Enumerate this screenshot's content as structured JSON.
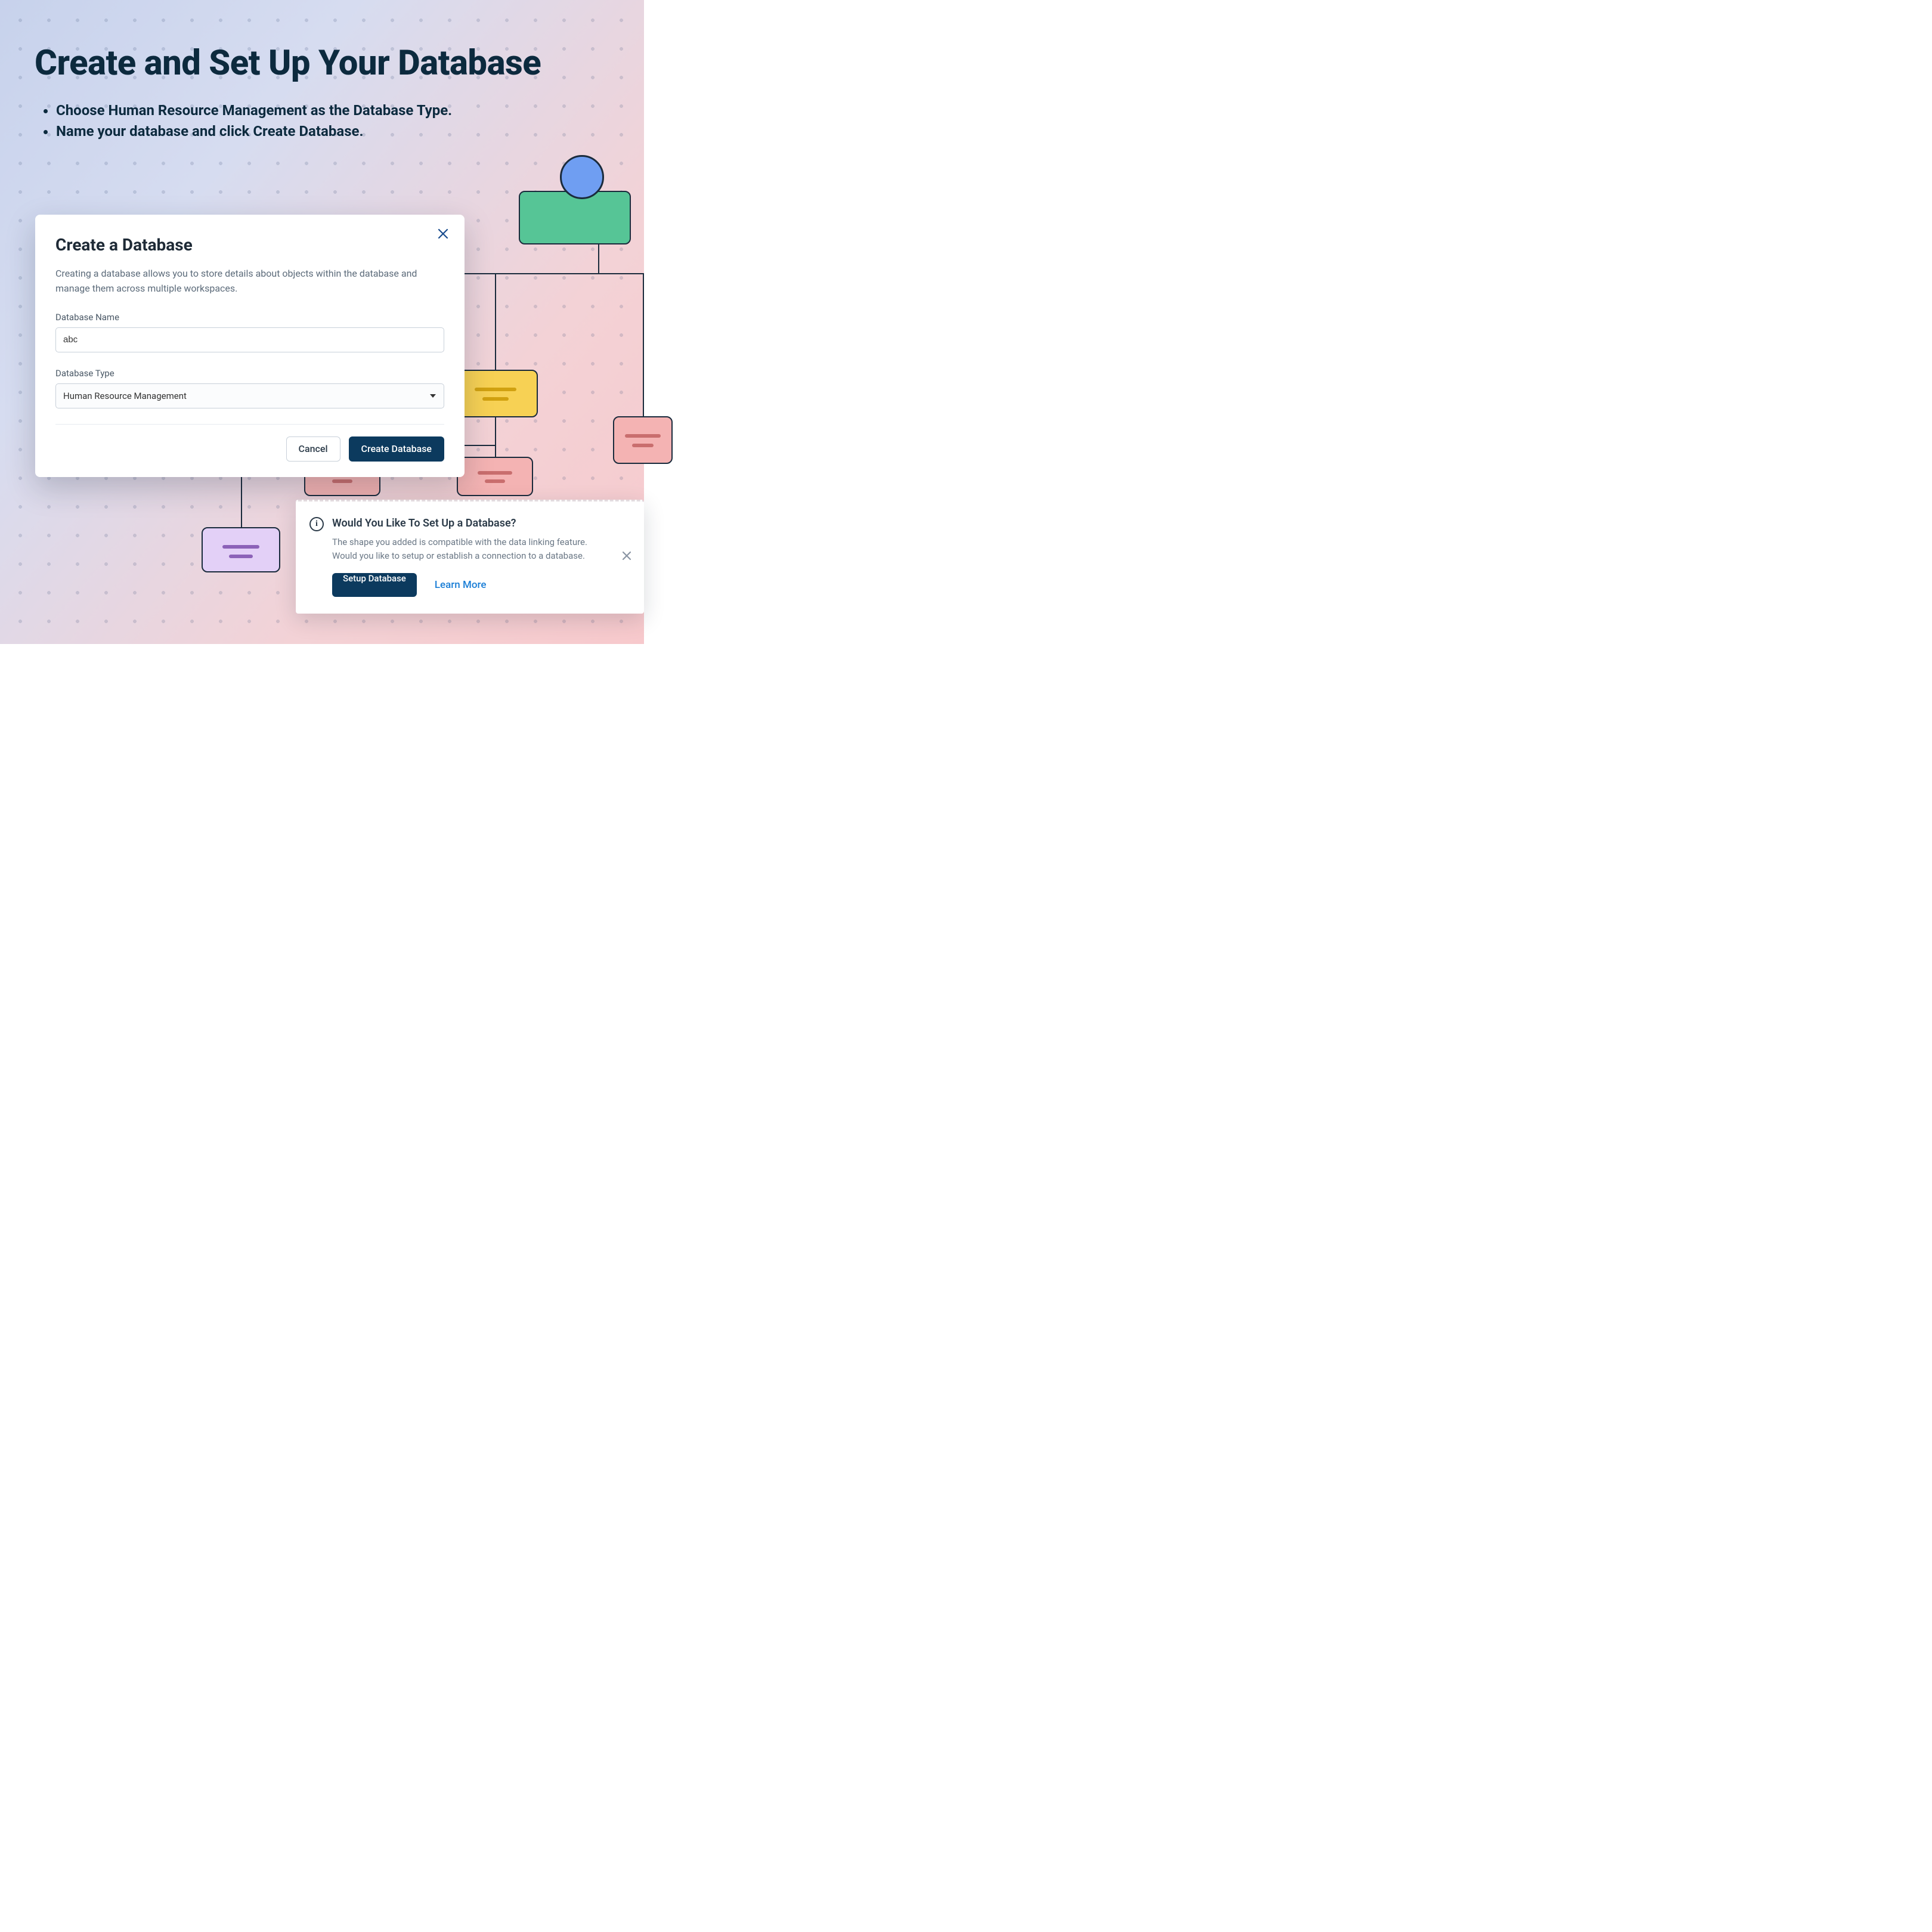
{
  "page": {
    "title": "Create and Set Up Your Database",
    "bullets": [
      "Choose Human Resource Management as the Database Type.",
      "Name your database and click Create Database."
    ]
  },
  "modal": {
    "title": "Create a Database",
    "description": "Creating a database allows you to store details about objects within the database and manage them across multiple workspaces.",
    "name_label": "Database Name",
    "name_value": "abc",
    "type_label": "Database Type",
    "type_value": "Human Resource Management",
    "cancel": "Cancel",
    "submit": "Create Database"
  },
  "toast": {
    "title": "Would You Like To Set Up a Database?",
    "body": "The shape you added is compatible with the data linking feature. Would you like to setup or establish a connection to a database.",
    "primary": "Setup Database",
    "link": "Learn More"
  }
}
